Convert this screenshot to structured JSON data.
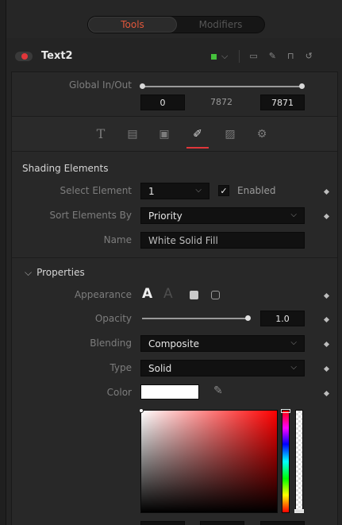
{
  "tabs": {
    "items": [
      "Tools",
      "Modifiers"
    ],
    "active": "Tools"
  },
  "node": {
    "title": "Text2",
    "color": "#45c13c"
  },
  "global_inout": {
    "label": "Global In/Out",
    "start": "0",
    "mid": "7872",
    "end": "7871"
  },
  "icon_tabs": [
    "text-icon",
    "layout-icon",
    "transform-icon",
    "shading-icon",
    "image-icon",
    "settings-icon"
  ],
  "shading": {
    "title": "Shading Elements",
    "select_element_label": "Select Element",
    "select_element_value": "1",
    "enabled_label": "Enabled",
    "enabled_checked": "✓",
    "sort_label": "Sort Elements By",
    "sort_value": "Priority",
    "name_label": "Name",
    "name_value": "White Solid Fill"
  },
  "properties": {
    "title": "Properties",
    "appearance_label": "Appearance",
    "appearance_glyph_1": "A",
    "appearance_glyph_2": "A",
    "opacity_label": "Opacity",
    "opacity_value": "1.0",
    "opacity_level": 1.0,
    "blending_label": "Blending",
    "blending_value": "Composite",
    "type_label": "Type",
    "type_value": "Solid",
    "color_label": "Color",
    "color_value": "#ffffff"
  },
  "accent_colors": {
    "active_tab": "#e2573b",
    "toggle": "#e1363a"
  }
}
